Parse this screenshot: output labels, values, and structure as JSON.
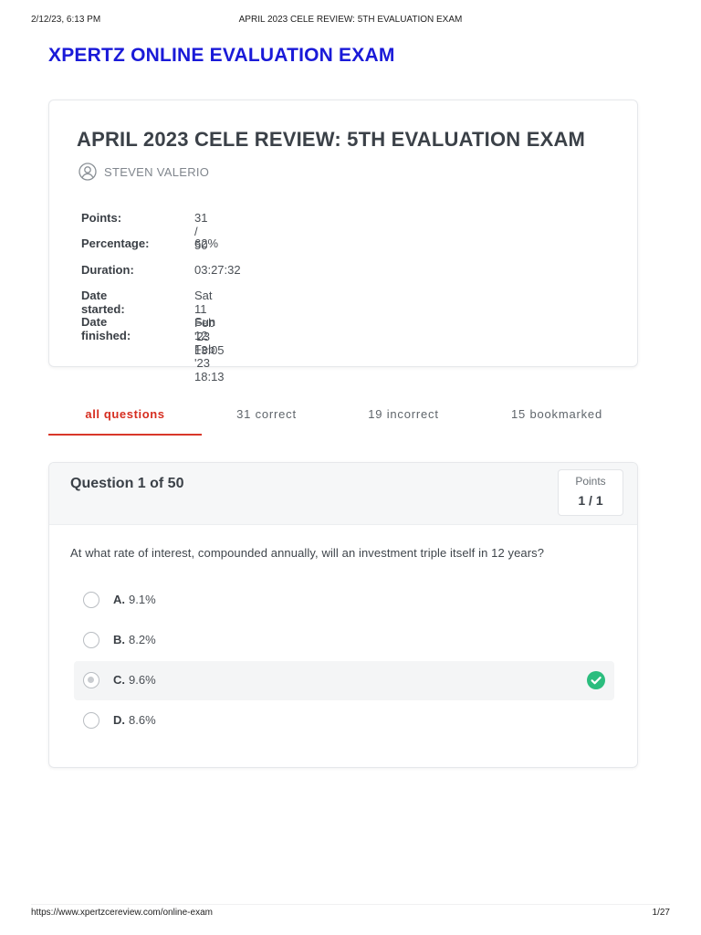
{
  "print_header": {
    "date": "2/12/23, 6:13 PM",
    "title": "APRIL 2023 CELE REVIEW: 5TH EVALUATION EXAM"
  },
  "site_title": "XPERTZ ONLINE EVALUATION EXAM",
  "summary": {
    "exam_title": "APRIL 2023 CELE REVIEW: 5TH EVALUATION EXAM",
    "user_name": "STEVEN VALERIO",
    "user_icon": "user-circle-icon",
    "stats": [
      {
        "label": "Points:",
        "value": "31 / 50"
      },
      {
        "label": "Percentage:",
        "value": "62%"
      },
      {
        "label": "Duration:",
        "value": "03:27:32"
      },
      {
        "label": "Date started:",
        "value": "Sat 11 Feb '23 13:05"
      },
      {
        "label": "Date finished:",
        "value": "Sun 12 Feb '23 18:13"
      }
    ]
  },
  "tabs": [
    {
      "label": "all questions",
      "active": true
    },
    {
      "label": "31 correct"
    },
    {
      "label": "19 incorrect"
    },
    {
      "label": "15 bookmarked"
    }
  ],
  "question": {
    "number_label": "Question 1 of 50",
    "points_label": "Points",
    "points_value": "1 / 1",
    "text": "At what rate of interest, compounded annually, will an investment triple itself in 12 years?",
    "options": [
      {
        "letter": "A.",
        "text": "9.1%",
        "selected": false
      },
      {
        "letter": "B.",
        "text": "8.2%",
        "selected": false
      },
      {
        "letter": "C.",
        "text": "9.6%",
        "selected": true,
        "correct": true
      },
      {
        "letter": "D.",
        "text": "8.6%",
        "selected": false
      }
    ]
  },
  "colors": {
    "brand": "#1a1ad8",
    "active_tab": "#d62e20",
    "correct": "#2bbd7e"
  },
  "print_footer": {
    "url": "https://www.xpertzcereview.com/online-exam",
    "page": "1/27"
  }
}
